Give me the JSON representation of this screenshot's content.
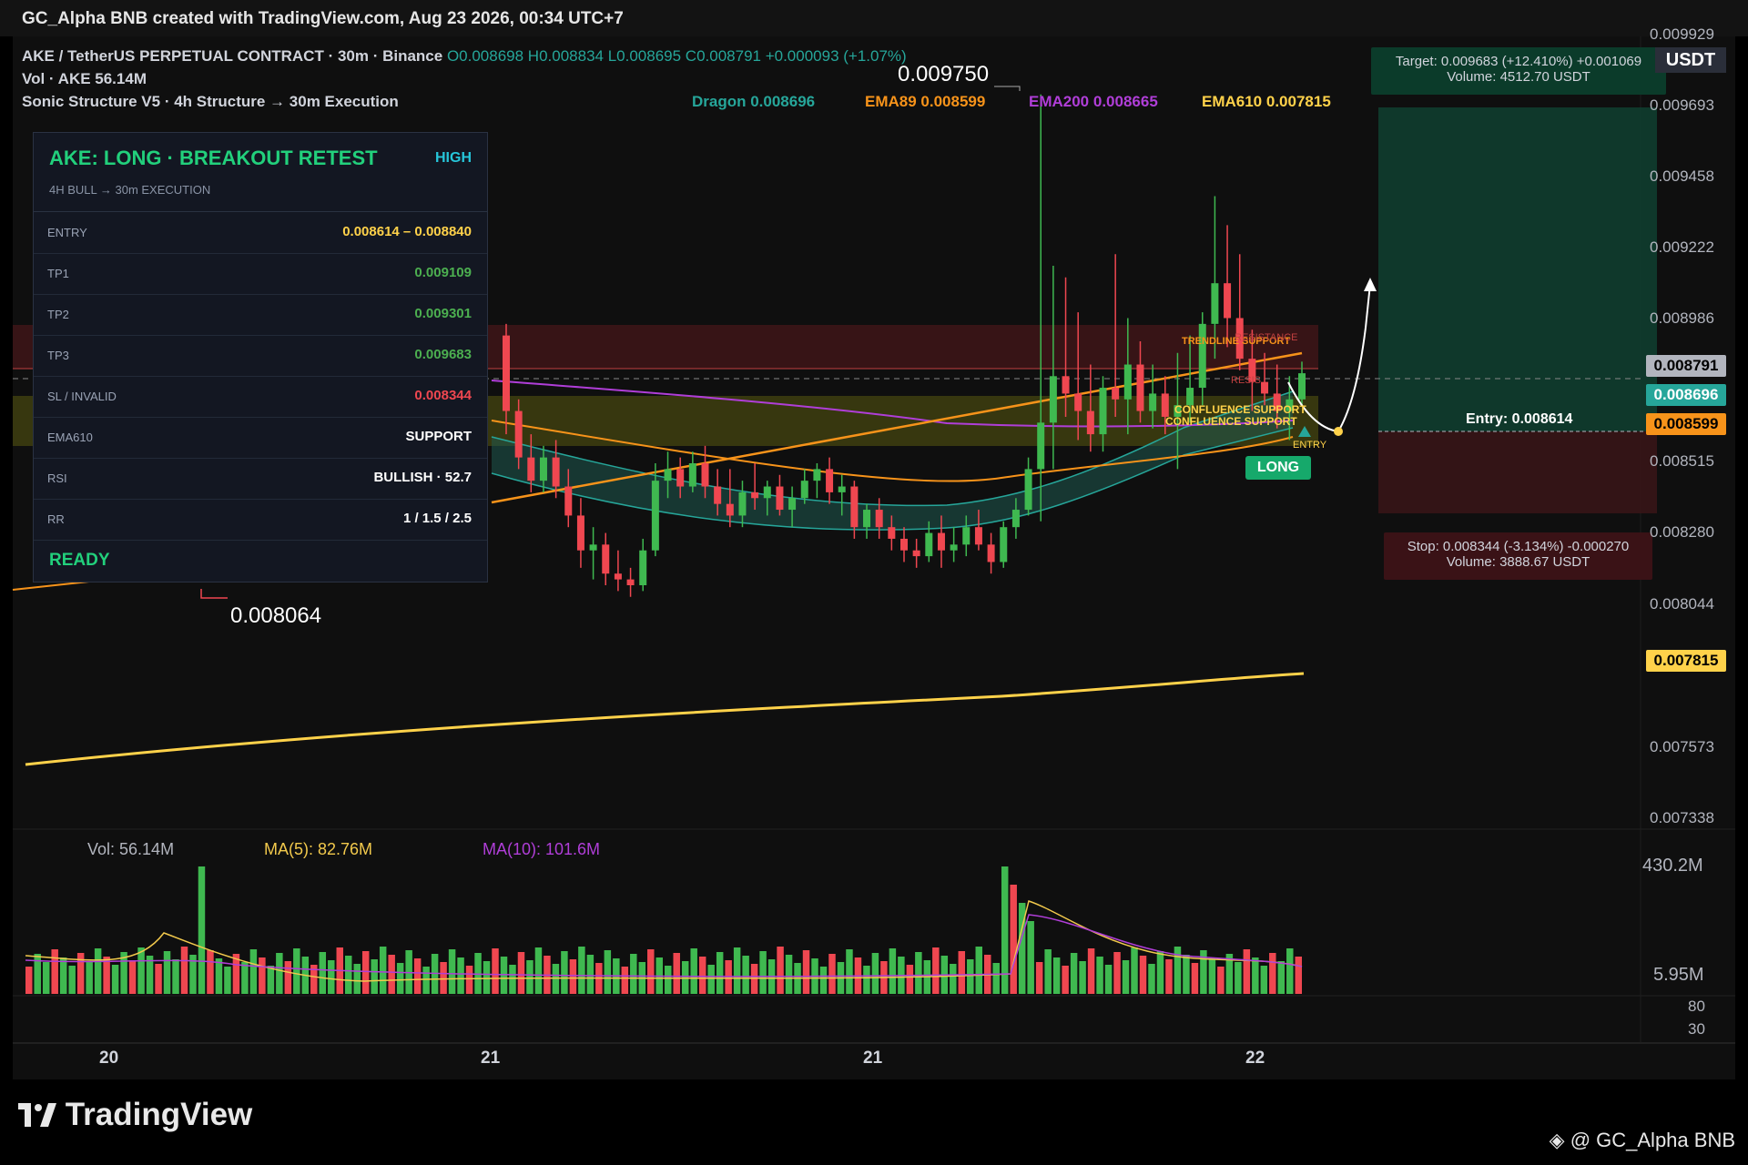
{
  "header": {
    "title": "GC_Alpha BNB created with TradingView.com, Aug 23 2026, 00:34 UTC+7"
  },
  "legend": {
    "symbol": "AKE / TetherUS PERPETUAL CONTRACT · 30m · Binance",
    "ohlc": "O0.008698 H0.008834 L0.008695 C0.008791 +0.000093 (+1.07%)",
    "vol": "Vol · AKE  56.14M",
    "indicator": "Sonic Structure V5 · 4h Structure → 30m Execution"
  },
  "indicators": {
    "dragon": "Dragon 0.008696",
    "ema89": "EMA89 0.008599",
    "ema200": "EMA200 0.008665",
    "ema610": "EMA610 0.007815",
    "colors": {
      "dragon": "#26a69a",
      "ema89": "#f7931a",
      "ema200": "#b03ed8",
      "ema610": "#ffd24a"
    }
  },
  "panel": {
    "title": "AKE: LONG · BREAKOUT RETEST",
    "badge": "HIGH",
    "subtitle": "4H BULL → 30m EXECUTION",
    "rows": [
      {
        "key": "ENTRY",
        "value": "0.008614 – 0.008840",
        "color": "#ffd24a"
      },
      {
        "key": "TP1",
        "value": "0.009109",
        "color": "#4caf50"
      },
      {
        "key": "TP2",
        "value": "0.009301",
        "color": "#4caf50"
      },
      {
        "key": "TP3",
        "value": "0.009683",
        "color": "#4caf50"
      },
      {
        "key": "SL / INVALID",
        "value": "0.008344",
        "color": "#ef4750"
      },
      {
        "key": "EMA610",
        "value": "SUPPORT",
        "color": "#ffffff"
      },
      {
        "key": "RSI",
        "value": "BULLISH · 52.7",
        "color": "#ffffff"
      },
      {
        "key": "RR",
        "value": "1 / 1.5 / 2.5",
        "color": "#ffffff"
      }
    ],
    "footer": "READY"
  },
  "annotations": {
    "high_label": "0.009750",
    "low_label": "0.008064",
    "target": "Target: 0.009683  (+12.410%)  +0.001069",
    "target_volume": "Volume: 4512.70 USDT",
    "stop": "Stop: 0.008344  (-3.134%)  -0.000270",
    "stop_volume": "Volume: 3888.67 USDT",
    "entry": "Entry: 0.008614",
    "long": "LONG",
    "entry_small": "ENTRY",
    "trendline": "TRENDLINE SUPPORT",
    "resistance": "RESISTANCE",
    "confluence1": "CONFLUENCE SUPPORT",
    "confluence2": "CONFLUENCE SUPPORT",
    "resis_short": "RESIS",
    "usdt": "USDT"
  },
  "price_axis": {
    "ticks": [
      "0.009929",
      "0.009693",
      "0.009458",
      "0.009222",
      "0.008986",
      "0.008515",
      "0.008280",
      "0.008044",
      "0.007573",
      "0.007338"
    ],
    "tags": [
      {
        "label": "0.008791",
        "bg": "#b2b5be",
        "fg": "#000000"
      },
      {
        "label": "0.008696",
        "bg": "#26a69a",
        "fg": "#ffffff"
      },
      {
        "label": "0.008599",
        "bg": "#f7931a",
        "fg": "#000000"
      },
      {
        "label": "0.007815",
        "bg": "#ffd24a",
        "fg": "#000000"
      }
    ]
  },
  "volume_pane": {
    "vol": "Vol: 56.14M",
    "ma5": "MA(5): 82.76M",
    "ma10": "MA(10): 101.6M",
    "axis_top": "430.2M",
    "axis_bottom": "5.95M",
    "rsi_80": "80",
    "rsi_30": "30"
  },
  "time_axis": [
    "20",
    "21",
    "21",
    "22"
  ],
  "footer": {
    "logo": "TradingView",
    "credit": "@ GC_Alpha BNB"
  },
  "chart_data": {
    "type": "candlestick",
    "interval": "30m",
    "ylim": [
      0.00722,
      0.00995
    ],
    "candles_approx": [
      [
        0.00892,
        0.00896,
        0.00858,
        0.00866
      ],
      [
        0.00866,
        0.0087,
        0.00846,
        0.0085
      ],
      [
        0.0085,
        0.00858,
        0.00838,
        0.00842
      ],
      [
        0.00842,
        0.00854,
        0.00838,
        0.0085
      ],
      [
        0.0085,
        0.00856,
        0.00836,
        0.0084
      ],
      [
        0.0084,
        0.00846,
        0.00826,
        0.0083
      ],
      [
        0.0083,
        0.00836,
        0.00812,
        0.00818
      ],
      [
        0.00818,
        0.00826,
        0.00808,
        0.0082
      ],
      [
        0.0082,
        0.00824,
        0.00806,
        0.0081
      ],
      [
        0.0081,
        0.00818,
        0.00804,
        0.00808
      ],
      [
        0.00808,
        0.00812,
        0.00802,
        0.00806
      ],
      [
        0.00806,
        0.00822,
        0.00804,
        0.00818
      ],
      [
        0.00818,
        0.00848,
        0.00816,
        0.00842
      ],
      [
        0.00842,
        0.00852,
        0.00836,
        0.00846
      ],
      [
        0.00846,
        0.0085,
        0.00836,
        0.0084
      ],
      [
        0.0084,
        0.00852,
        0.00838,
        0.00848
      ],
      [
        0.00848,
        0.00854,
        0.00836,
        0.0084
      ],
      [
        0.0084,
        0.00846,
        0.0083,
        0.00834
      ],
      [
        0.00834,
        0.00846,
        0.00826,
        0.0083
      ],
      [
        0.0083,
        0.00842,
        0.00826,
        0.00838
      ],
      [
        0.00838,
        0.00848,
        0.00832,
        0.00836
      ],
      [
        0.00836,
        0.00842,
        0.0083,
        0.0084
      ],
      [
        0.0084,
        0.00844,
        0.0083,
        0.00832
      ],
      [
        0.00832,
        0.0084,
        0.00826,
        0.00836
      ],
      [
        0.00836,
        0.00846,
        0.00834,
        0.00842
      ],
      [
        0.00842,
        0.00848,
        0.00836,
        0.00846
      ],
      [
        0.00846,
        0.0085,
        0.00834,
        0.00838
      ],
      [
        0.00838,
        0.00844,
        0.0083,
        0.0084
      ],
      [
        0.0084,
        0.00842,
        0.00822,
        0.00826
      ],
      [
        0.00826,
        0.00834,
        0.00822,
        0.00832
      ],
      [
        0.00832,
        0.00836,
        0.00822,
        0.00826
      ],
      [
        0.00826,
        0.0083,
        0.00818,
        0.00822
      ],
      [
        0.00822,
        0.00826,
        0.00814,
        0.00818
      ],
      [
        0.00818,
        0.00822,
        0.00812,
        0.00816
      ],
      [
        0.00816,
        0.00828,
        0.00814,
        0.00824
      ],
      [
        0.00824,
        0.0083,
        0.00812,
        0.00818
      ],
      [
        0.00818,
        0.00826,
        0.00814,
        0.0082
      ],
      [
        0.0082,
        0.0083,
        0.00816,
        0.00826
      ],
      [
        0.00826,
        0.00832,
        0.00818,
        0.0082
      ],
      [
        0.0082,
        0.00824,
        0.0081,
        0.00814
      ],
      [
        0.00814,
        0.00828,
        0.00812,
        0.00826
      ],
      [
        0.00826,
        0.00836,
        0.00822,
        0.00832
      ],
      [
        0.00832,
        0.0085,
        0.0083,
        0.00846
      ],
      [
        0.00846,
        0.00975,
        0.00828,
        0.00862
      ],
      [
        0.00862,
        0.00916,
        0.00846,
        0.00878
      ],
      [
        0.00878,
        0.00912,
        0.00864,
        0.00872
      ],
      [
        0.00872,
        0.009,
        0.00856,
        0.00866
      ],
      [
        0.00866,
        0.00882,
        0.00852,
        0.00858
      ],
      [
        0.00858,
        0.00878,
        0.00852,
        0.00874
      ],
      [
        0.00874,
        0.0092,
        0.00864,
        0.0087
      ],
      [
        0.0087,
        0.00898,
        0.00858,
        0.00882
      ],
      [
        0.00882,
        0.0089,
        0.00862,
        0.00866
      ],
      [
        0.00866,
        0.00882,
        0.0086,
        0.00872
      ],
      [
        0.00872,
        0.00878,
        0.00858,
        0.00864
      ],
      [
        0.00864,
        0.00886,
        0.00846,
        0.00868
      ],
      [
        0.00868,
        0.00892,
        0.00862,
        0.00874
      ],
      [
        0.00874,
        0.009,
        0.00868,
        0.00896
      ],
      [
        0.00896,
        0.0094,
        0.00884,
        0.0091
      ],
      [
        0.0091,
        0.0093,
        0.00888,
        0.00898
      ],
      [
        0.00898,
        0.0092,
        0.0088,
        0.00884
      ],
      [
        0.00884,
        0.00894,
        0.00866,
        0.00876
      ],
      [
        0.00876,
        0.00886,
        0.00868,
        0.00872
      ],
      [
        0.00872,
        0.00882,
        0.0086,
        0.00866
      ],
      [
        0.00866,
        0.00878,
        0.00856,
        0.0087
      ],
      [
        0.0087,
        0.00883,
        0.00868,
        0.00879
      ]
    ]
  }
}
